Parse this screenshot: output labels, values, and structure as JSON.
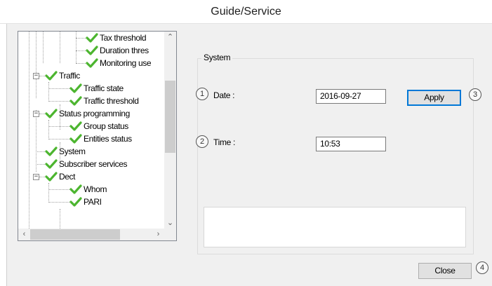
{
  "window": {
    "title": "Guide/Service"
  },
  "tree": {
    "items": [
      {
        "label": "Tax threshold"
      },
      {
        "label": "Duration thres"
      },
      {
        "label": "Monitoring use"
      },
      {
        "label": "Traffic"
      },
      {
        "label": "Traffic state"
      },
      {
        "label": "Traffic threshold"
      },
      {
        "label": "Status programming"
      },
      {
        "label": "Group status"
      },
      {
        "label": "Entities status"
      },
      {
        "label": "System"
      },
      {
        "label": "Subscriber services"
      },
      {
        "label": "Dect"
      },
      {
        "label": "Whom"
      },
      {
        "label": "PARI"
      }
    ],
    "expand_symbol": "−",
    "check_color": "#4cb52f"
  },
  "system": {
    "legend": "System",
    "date_label": "Date :",
    "date_value": "2016-09-27",
    "time_label": "Time :",
    "time_value": "10:53",
    "apply_label": "Apply",
    "notes_value": ""
  },
  "callouts": {
    "c1": "1",
    "c2": "2",
    "c3": "3",
    "c4": "4"
  },
  "footer": {
    "close_label": "Close"
  }
}
